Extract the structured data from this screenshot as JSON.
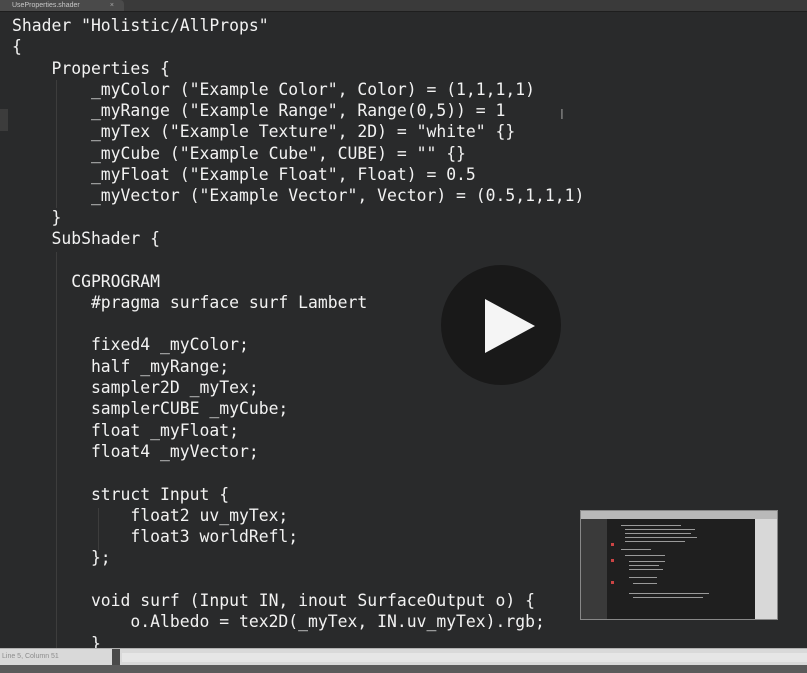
{
  "tab": {
    "title": "UseProperties.shader",
    "close": "×"
  },
  "code_lines": [
    "Shader \"Holistic/AllProps\"",
    "{",
    "    Properties {",
    "        _myColor (\"Example Color\", Color) = (1,1,1,1)",
    "        _myRange (\"Example Range\", Range(0,5)) = 1",
    "        _myTex (\"Example Texture\", 2D) = \"white\" {}",
    "        _myCube (\"Example Cube\", CUBE) = \"\" {}",
    "        _myFloat (\"Example Float\", Float) = 0.5",
    "        _myVector (\"Example Vector\", Vector) = (0.5,1,1,1)",
    "    }",
    "    SubShader {",
    "",
    "      CGPROGRAM",
    "        #pragma surface surf Lambert",
    "",
    "        fixed4 _myColor;",
    "        half _myRange;",
    "        sampler2D _myTex;",
    "        samplerCUBE _myCube;",
    "        float _myFloat;",
    "        float4 _myVector;",
    "",
    "        struct Input {",
    "            float2 uv_myTex;",
    "            float3 worldRefl;",
    "        };",
    "",
    "        void surf (Input IN, inout SurfaceOutput o) {",
    "            o.Albedo = tex2D(_myTex, IN.uv_myTex).rgb;",
    "        }"
  ],
  "cursor_glyph": "I",
  "status": {
    "position": "Line 5, Column 51"
  },
  "icons": {
    "play": "play-icon",
    "close": "close-icon"
  },
  "colors": {
    "editor_bg": "#292a2b",
    "text": "#f2f2f2",
    "status_bg": "#d9d9d9"
  }
}
